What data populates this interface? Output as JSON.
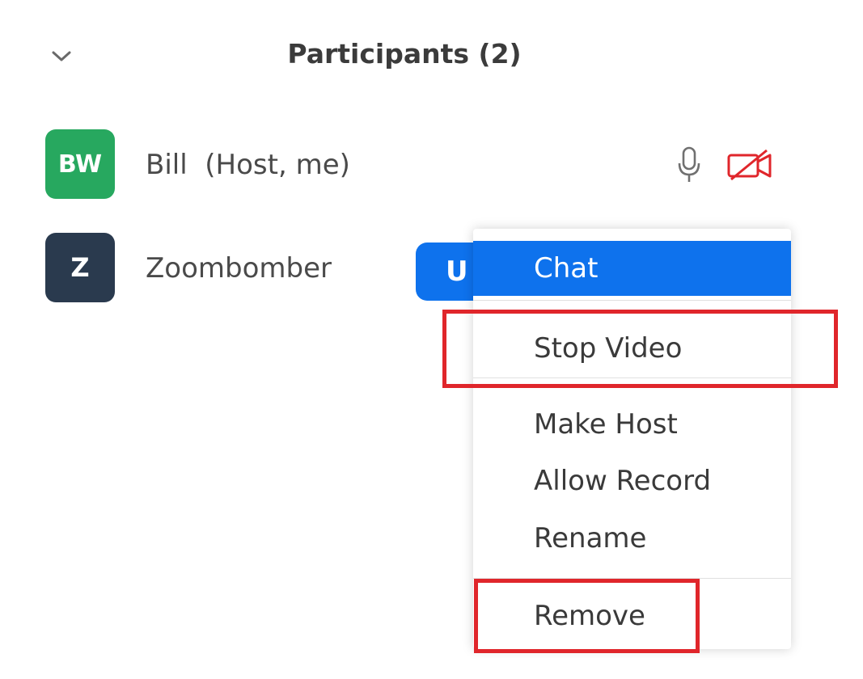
{
  "header": {
    "title": "Participants (2)",
    "collapse_icon": "chevron-down-icon"
  },
  "participants": [
    {
      "initials": "BW",
      "name": "Bill  (Host, me)",
      "avatar_color": "#27a85f",
      "mic_icon": "microphone-icon",
      "video_icon": "video-off-icon",
      "video_icon_color": "#e0262b"
    },
    {
      "initials": "Z",
      "name": "Zoombomber",
      "avatar_color": "#2a3a4e"
    }
  ],
  "unmute_button": {
    "label": "U",
    "color": "#0e72ed"
  },
  "context_menu": {
    "items": [
      {
        "label": "Chat",
        "active": true
      },
      {
        "label": "Stop Video",
        "highlighted": true
      },
      {
        "label": "Make Host"
      },
      {
        "label": "Allow Record"
      },
      {
        "label": "Rename"
      },
      {
        "label": "Remove",
        "highlighted": true
      }
    ],
    "active_color": "#0e72ed",
    "highlight_color": "#e0262b"
  }
}
